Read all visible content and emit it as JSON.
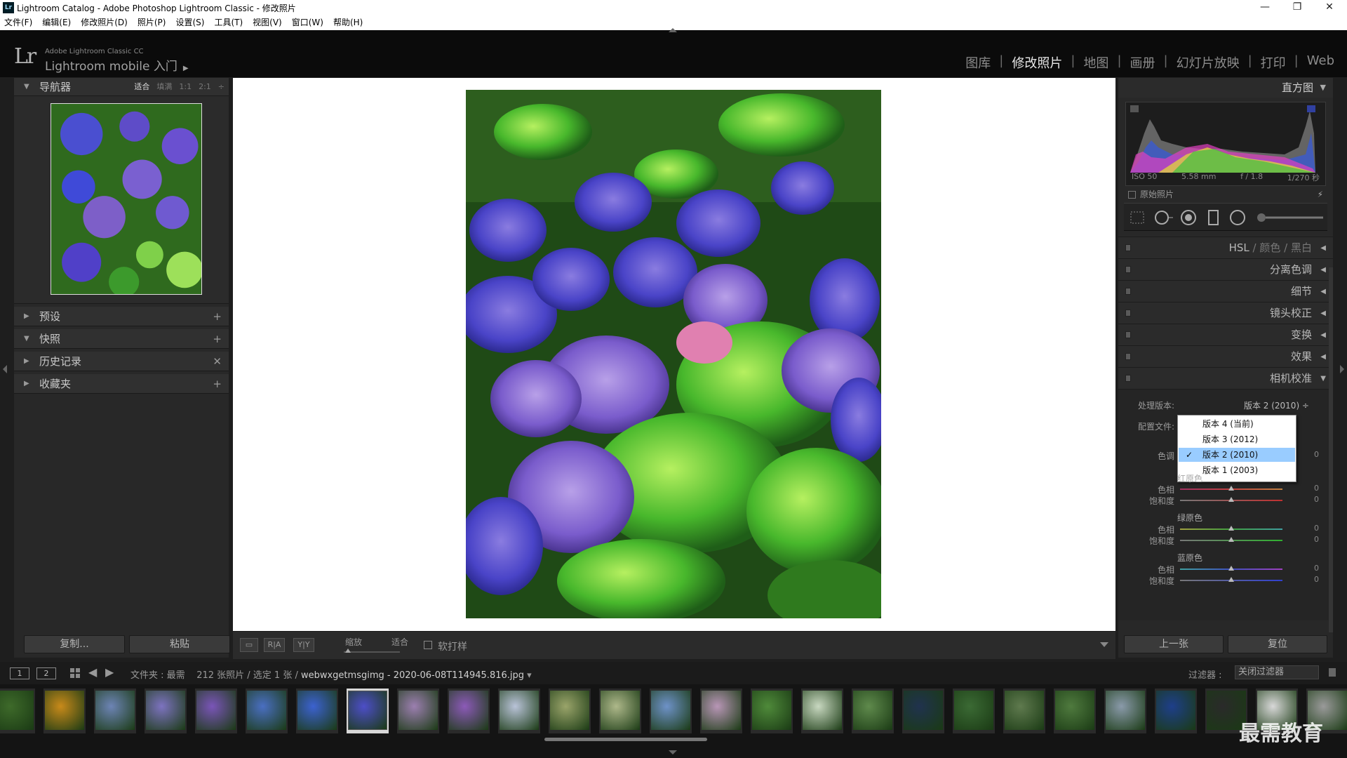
{
  "window": {
    "title": "Lightroom Catalog - Adobe Photoshop Lightroom Classic - 修改照片",
    "icon_text": "Lr",
    "minimize": "—",
    "restore": "❐",
    "close": "✕"
  },
  "menu": [
    "文件(F)",
    "编辑(E)",
    "修改照片(D)",
    "照片(P)",
    "设置(S)",
    "工具(T)",
    "视图(V)",
    "窗口(W)",
    "帮助(H)"
  ],
  "header": {
    "logo": "Lr",
    "product": "Adobe Lightroom Classic CC",
    "identity": "Lightroom mobile 入门",
    "identity_arrow": "▶",
    "modules": [
      "图库",
      "修改照片",
      "地图",
      "画册",
      "幻灯片放映",
      "打印",
      "Web"
    ],
    "active_module": "修改照片",
    "separator": "|"
  },
  "left_panel": {
    "navigator": {
      "title": "导航器",
      "zoom_options": [
        "适合",
        "填满",
        "1:1",
        "2:1"
      ],
      "active_zoom": "适合",
      "zoom_more": "÷"
    },
    "sections": [
      {
        "name": "presets",
        "title": "预设",
        "arrow": "▶",
        "action": "+"
      },
      {
        "name": "snapshots",
        "title": "快照",
        "arrow": "▼",
        "action": "+"
      },
      {
        "name": "history",
        "title": "历史记录",
        "arrow": "▶",
        "action": "✕"
      },
      {
        "name": "collections",
        "title": "收藏夹",
        "arrow": "▶",
        "action": "+"
      }
    ],
    "copy_button": "复制...",
    "paste_button": "粘贴"
  },
  "toolbar": {
    "view_loupe": "▭",
    "view_ra": "R|A",
    "view_yy": "Y|Y",
    "zoom_label": "缩放",
    "zoom_value": "适合",
    "softproof_label": "软打样"
  },
  "right_panel": {
    "histogram_title": "直方图",
    "histogram_arrow": "▼",
    "meta": {
      "iso": "ISO 50",
      "focal": "5.58 mm",
      "aperture": "f / 1.8",
      "shutter": "1/270 秒"
    },
    "original_photo": "原始照片",
    "flash_icon": "⚡",
    "sections": [
      {
        "name": "hsl",
        "title": "HSL",
        "extra": [
          "颜色",
          "黑白"
        ],
        "arrow": "◀"
      },
      {
        "name": "split-toning",
        "title": "分离色调",
        "arrow": "◀"
      },
      {
        "name": "detail",
        "title": "细节",
        "arrow": "◀"
      },
      {
        "name": "lens-corrections",
        "title": "镜头校正",
        "arrow": "◀"
      },
      {
        "name": "transform",
        "title": "变换",
        "arrow": "◀"
      },
      {
        "name": "effects",
        "title": "效果",
        "arrow": "◀"
      },
      {
        "name": "camera-calibration",
        "title": "相机校准",
        "arrow": "▼"
      }
    ],
    "calibration": {
      "process_label": "处理版本:",
      "process_value": "版本 2 (2010) ÷",
      "profile_label": "配置文件:",
      "tint_label": "色调",
      "tint_value": "0",
      "dropdown": [
        {
          "label": "版本 4 (当前)",
          "selected": false
        },
        {
          "label": "版本 3 (2012)",
          "selected": false
        },
        {
          "label": "版本 2 (2010)",
          "selected": true
        },
        {
          "label": "版本 1 (2003)",
          "selected": false
        }
      ],
      "check": "✓",
      "groups": [
        {
          "name": "red",
          "title": "红原色",
          "hue_label": "色相",
          "sat_label": "饱和度",
          "hue": "0",
          "sat": "0",
          "color": "#c04040"
        },
        {
          "name": "green",
          "title": "绿原色",
          "hue_label": "色相",
          "sat_label": "饱和度",
          "hue": "0",
          "sat": "0",
          "color": "#40a040"
        },
        {
          "name": "blue",
          "title": "蓝原色",
          "hue_label": "色相",
          "sat_label": "饱和度",
          "hue": "0",
          "sat": "0",
          "color": "#4050c0"
        }
      ]
    },
    "prev_button": "上一张",
    "reset_button": "复位"
  },
  "filmstrip_bar": {
    "screen1": "1",
    "screen2": "2",
    "back": "◀",
    "forward": "▶",
    "path_prefix": "文件夹 : 最需",
    "count": "212 张照片 / 选定 1 张 /",
    "filename": "webwxgetmsgimg - 2020-06-08T114945.816.jpg",
    "dropdown_arrow": "▾",
    "filter_label": "过滤器 :",
    "filter_value": "关闭过滤器"
  },
  "filmstrip": {
    "selected_index": 7,
    "thumbs": [
      {
        "color": "#3e6a2a"
      },
      {
        "color": "#c88a1a"
      },
      {
        "color": "#6d84b5"
      },
      {
        "color": "#7d73c0"
      },
      {
        "color": "#7a55b8"
      },
      {
        "color": "#4a6fc2"
      },
      {
        "color": "#3c62d0"
      },
      {
        "color": "#4d4ec8"
      },
      {
        "color": "#9c7fb0"
      },
      {
        "color": "#8c5ab8"
      },
      {
        "color": "#b9c3d8"
      },
      {
        "color": "#9aa46a"
      },
      {
        "color": "#aeb88a"
      },
      {
        "color": "#6e92c8"
      },
      {
        "color": "#b896b6"
      },
      {
        "color": "#4f8a3a"
      },
      {
        "color": "#c8d8c0"
      },
      {
        "color": "#5f8a4c"
      },
      {
        "color": "#20324e"
      },
      {
        "color": "#3b6a34"
      },
      {
        "color": "#5f7a4e"
      },
      {
        "color": "#4f7a3e"
      },
      {
        "color": "#8a9aaa"
      },
      {
        "color": "#1e3f8a"
      },
      {
        "color": "#2a2a2a"
      },
      {
        "color": "#d8d8d8"
      },
      {
        "color": "#9a9a9a"
      }
    ]
  },
  "watermark": "最需教育"
}
